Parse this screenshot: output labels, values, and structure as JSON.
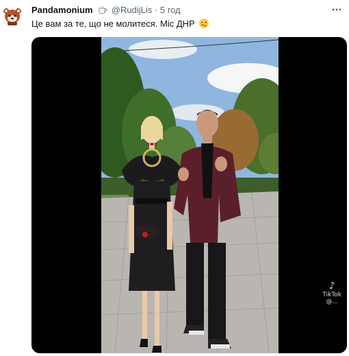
{
  "tweet": {
    "author_name": "Pandamonium",
    "author_emoji": "coffee-cup-icon",
    "handle": "@RudijLis",
    "separator": "·",
    "time": "5 год",
    "text": "Це вам за те, що не молитеся. Міс ДНР",
    "text_emoji": "woozy-face-icon"
  },
  "media": {
    "watermark_logo": "TikTok",
    "watermark_handle": "@..."
  },
  "colors": {
    "secondary_text": "#536471",
    "primary_text": "#0f1419",
    "media_bg": "#000000"
  }
}
